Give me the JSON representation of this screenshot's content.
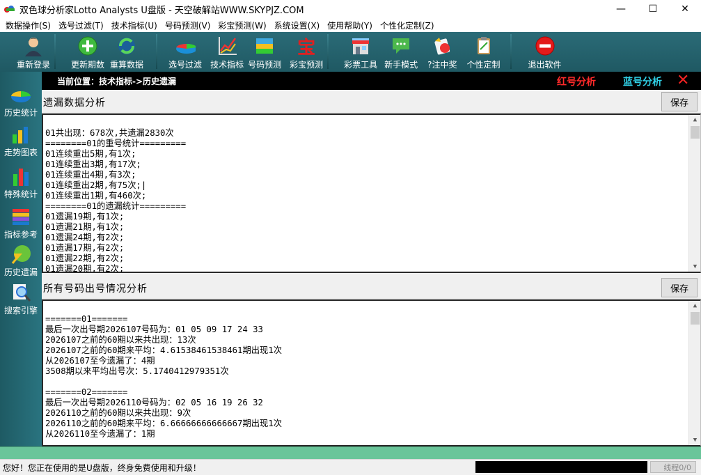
{
  "window": {
    "title": "双色球分析家Lotto Analysts U盘版 - 天空破解站WWW.SKYPJZ.COM",
    "minimize": "—",
    "maximize": "☐",
    "close": "✕"
  },
  "menu": [
    "数据操作(S)",
    "选号过滤(T)",
    "技术指标(U)",
    "号码预测(V)",
    "彩宝预测(W)",
    "系统设置(X)",
    "使用帮助(Y)",
    "个性化定制(Z)"
  ],
  "toolbar": [
    {
      "label": "重新登录",
      "icon": "user-icon"
    },
    {
      "label": "更新期数",
      "icon": "plus-icon"
    },
    {
      "label": "重算数据",
      "icon": "refresh-icon"
    },
    {
      "label": "选号过滤",
      "icon": "filter-icon"
    },
    {
      "label": "技术指标",
      "icon": "chart-line-icon"
    },
    {
      "label": "号码预测",
      "icon": "palette-icon"
    },
    {
      "label": "彩宝预测",
      "icon": "treasure-icon"
    },
    {
      "label": "彩票工具",
      "icon": "shop-icon"
    },
    {
      "label": "新手模式",
      "icon": "chat-icon"
    },
    {
      "label": "?注中奖",
      "icon": "prize-icon"
    },
    {
      "label": "个性定制",
      "icon": "clipboard-icon"
    },
    {
      "label": "退出软件",
      "icon": "exit-icon"
    }
  ],
  "sidebar": [
    {
      "label": "历史统计",
      "icon": "pie-chart-icon"
    },
    {
      "label": "走势图表",
      "icon": "bar-chart-icon"
    },
    {
      "label": "特殊统计",
      "icon": "column-chart-icon"
    },
    {
      "label": "指标参考",
      "icon": "book-icon"
    },
    {
      "label": "历史遗漏",
      "icon": "pie-slice-icon"
    },
    {
      "label": "搜索引擎",
      "icon": "magnifier-icon"
    }
  ],
  "location": {
    "text": "当前位置：技术指标->历史遗漏",
    "red_tab": "红号分析",
    "blue_tab": "蓝号分析",
    "close": "✕"
  },
  "panel1": {
    "title": "遗漏数据分析",
    "save": "保存",
    "lines": [
      "",
      "01共出现：678次,共遗漏2830次",
      "========01的重号统计=========",
      "01连续重出5期,有1次;",
      "01连续重出3期,有17次;",
      "01连续重出4期,有3次;",
      "01连续重出2期,有75次;|",
      "01连续重出1期,有460次;",
      "========01的遗漏统计=========",
      "01遗漏19期,有1次;",
      "01遗漏21期,有1次;",
      "01遗漏24期,有2次;",
      "01遗漏17期,有2次;",
      "01遗漏22期,有2次;",
      "01遗漏20期,有2次;"
    ]
  },
  "panel2": {
    "title": "所有号码出号情况分析",
    "save": "保存",
    "lines": [
      "",
      "=======01=======",
      "最后一次出号期2026107号码为：01 05 09 17 24 33",
      "2026107之前的60期以来共出现：13次",
      "2026107之前的60期来平均：4.61538461538461期出现1次",
      "从2026107至今遗漏了：4期",
      "3508期以来平均出号次：5.1740412979351次",
      "",
      "=======02=======",
      "最后一次出号期2026110号码为：02 05 16 19 26 32",
      "2026110之前的60期以来共出现：9次",
      "2026110之前的60期来平均：6.66666666666667期出现1次",
      "从2026110至今遗漏了：1期"
    ]
  },
  "status": {
    "text": "您好！您正在使用的是U盘版，终身免费使用和升级！",
    "thread": "线程0/0"
  }
}
